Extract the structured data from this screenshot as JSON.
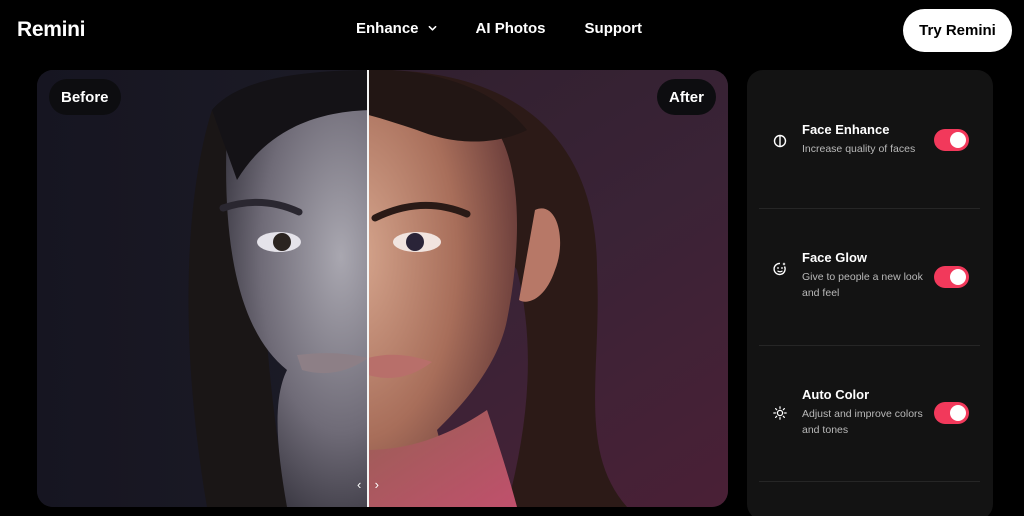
{
  "brand": {
    "logo": "Remini"
  },
  "nav": {
    "items": [
      {
        "label": "Enhance"
      },
      {
        "label": "AI Photos"
      },
      {
        "label": "Support"
      }
    ],
    "cta": "Try Remini"
  },
  "viewer": {
    "before_label": "Before",
    "after_label": "After",
    "slider_position": 0.48
  },
  "panel": {
    "features": [
      {
        "title": "Face Enhance",
        "description": "Increase quality of faces",
        "enabled": true,
        "icon": "face-enhance-icon"
      },
      {
        "title": "Face Glow",
        "description": "Give to people a new look and feel",
        "enabled": true,
        "icon": "face-glow-icon"
      },
      {
        "title": "Auto Color",
        "description": "Adjust and improve colors and tones",
        "enabled": true,
        "icon": "sun-icon"
      }
    ]
  },
  "colors": {
    "accent": "#f2395b",
    "background": "#000000",
    "panel": "#131313"
  }
}
